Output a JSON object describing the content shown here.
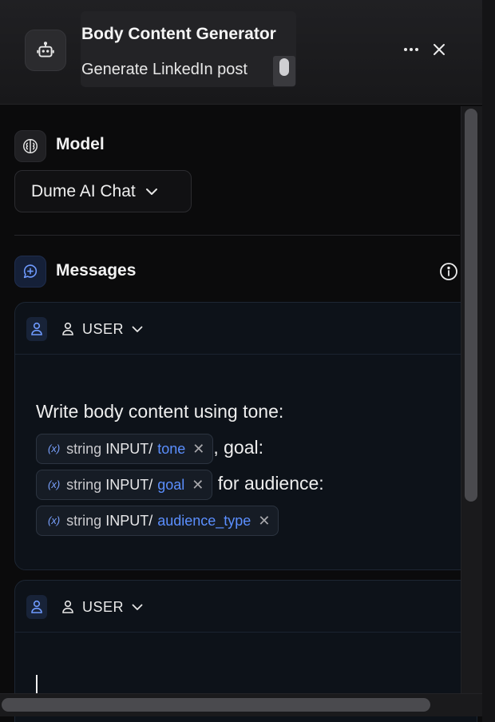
{
  "header": {
    "title": "Body Content Generator",
    "subtitle": "Generate LinkedIn post",
    "icon": "bot-icon",
    "actions": [
      "more-icon",
      "close-icon"
    ]
  },
  "model": {
    "label": "Model",
    "icon": "brain-icon",
    "selected": "Dume AI Chat"
  },
  "messages": {
    "label": "Messages",
    "icon": "message-plus-icon",
    "info_icon": "info-icon",
    "items": [
      {
        "role": "USER",
        "text_parts": {
          "p1": "Write body content using tone:",
          "p2": ", goal:",
          "p3": " for audience:"
        },
        "variables": [
          {
            "type": "string",
            "source": "INPUT/",
            "name": "tone"
          },
          {
            "type": "string",
            "source": "INPUT/",
            "name": "goal"
          },
          {
            "type": "string",
            "source": "INPUT/",
            "name": "audience_type"
          }
        ]
      },
      {
        "role": "USER",
        "text": ""
      }
    ]
  },
  "colors": {
    "accent": "#5b8fff",
    "background": "#0b0b0c",
    "card": "#0d1219"
  }
}
